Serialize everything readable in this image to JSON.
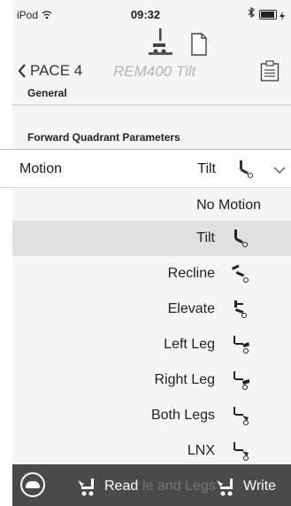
{
  "status_bar": {
    "carrier": "iPod",
    "time": "09:32"
  },
  "nav": {
    "back_label": "PACE 4",
    "subtitle": "REM400 Tilt"
  },
  "sections": {
    "general": "General",
    "forward": "Forward Quadrant Parameters"
  },
  "motion": {
    "label": "Motion",
    "value": "Tilt"
  },
  "options": [
    {
      "label": "No Motion"
    },
    {
      "label": "Tilt",
      "selected": true
    },
    {
      "label": "Recline"
    },
    {
      "label": "Elevate"
    },
    {
      "label": "Left Leg"
    },
    {
      "label": "Right Leg"
    },
    {
      "label": "Both Legs"
    },
    {
      "label": "LNX"
    }
  ],
  "toolbar": {
    "read_label": "Read",
    "write_label": "Write",
    "ghost_label": "le and Legs"
  },
  "colors": {
    "toolbar_bg": "#4a4a4a",
    "selected_row": "#e0e0e0",
    "content_bg": "#f5f5f6"
  }
}
